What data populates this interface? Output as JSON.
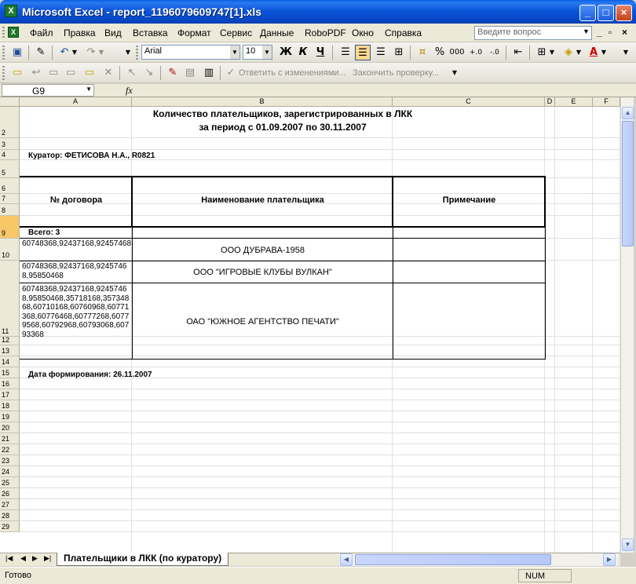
{
  "window": {
    "title": "Microsoft Excel - report_1196079609747[1].xls"
  },
  "menu": {
    "items": [
      "Файл",
      "Правка",
      "Вид",
      "Вставка",
      "Формат",
      "Сервис",
      "Данные",
      "RoboPDF",
      "Окно",
      "Справка"
    ],
    "help_placeholder": "Введите вопрос"
  },
  "toolbar": {
    "font_name": "Arial",
    "font_size": "10",
    "bold": "Ж",
    "italic": "К",
    "underline": "Ч",
    "percent": "%",
    "thousands": "000",
    "reply_changes": "Ответить с изменениями...",
    "end_review": "Закончить проверку..."
  },
  "formula": {
    "cell_ref": "G9",
    "fx": "fx"
  },
  "columns": [
    "A",
    "B",
    "C",
    "D",
    "E",
    "F"
  ],
  "rows": [
    "2",
    "3",
    "4",
    "5",
    "6",
    "7",
    "8",
    "9",
    "10",
    "11",
    "12",
    "13",
    "14",
    "15",
    "16",
    "17",
    "18",
    "19",
    "20",
    "21",
    "22",
    "23",
    "24",
    "25",
    "26",
    "27",
    "28",
    "29"
  ],
  "report": {
    "title_line1": "Количество плательщиков, зарегистрированных в ЛКК",
    "title_line2": "за период с 01.09.2007 по 30.11.2007",
    "curator": "Куратор: ФЕТИСОВА Н.А.,  R0821",
    "headers": [
      "№ договора",
      "Наименование плательщика",
      "Примечание"
    ],
    "total": "Всего: 3",
    "data_rows": [
      {
        "contract": "60748368,92437168,92457468",
        "payer": "ООО ДУБРАВА-1958",
        "note": ""
      },
      {
        "contract": "60748368,92437168,92457468,95850468",
        "payer": "ООО \"ИГРОВЫЕ КЛУБЫ ВУЛКАН\"",
        "note": ""
      },
      {
        "contract": "60748368,92437168,92457468,95850468,35718168,35734868,60710168,60760968,60771368,60776468,60777268,60779568,60792968,60793068,60793368",
        "payer": "ОАО \"ЮЖНОЕ АГЕНТСТВО ПЕЧАТИ\"",
        "note": ""
      }
    ],
    "date_line": "Дата формирования:  26.11.2007"
  },
  "sheet": {
    "tab_label": "Плательщики в ЛКК (по куратору)"
  },
  "status": {
    "ready": "Готово",
    "num": "NUM"
  }
}
